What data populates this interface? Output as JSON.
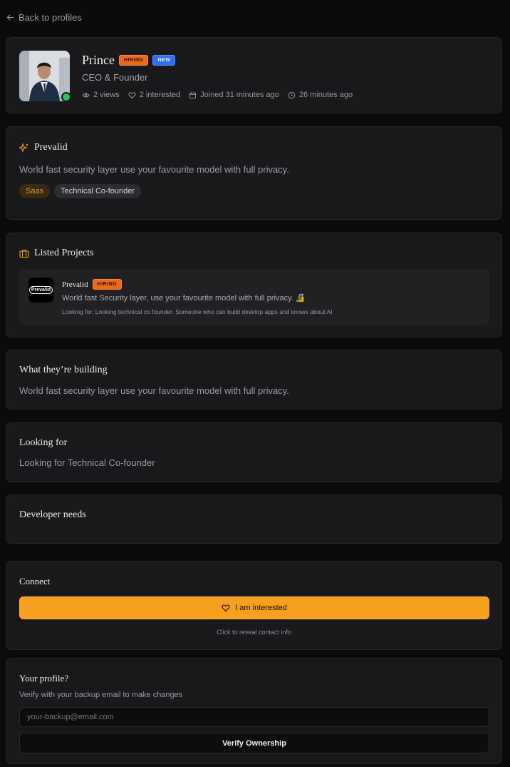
{
  "nav": {
    "back_label": "Back to profiles"
  },
  "profile": {
    "name": "Prince",
    "badges": {
      "hiring": "HIRING",
      "new": "NEW"
    },
    "role": "CEO & Founder",
    "stats": {
      "views": "2 views",
      "interested": "2 interested",
      "joined": "Joined 31 minutes ago",
      "updated": "26 minutes ago"
    },
    "online_color": "#22c55e"
  },
  "company": {
    "name": "Prevalid",
    "description": "World fast security layer use your favourite model with full privacy.",
    "tags": [
      "Saas",
      "Technical Co-founder"
    ]
  },
  "listed_projects": {
    "title": "Listed Projects",
    "project": {
      "logo_text": "Prevalid",
      "name": "Prevalid",
      "badge": "HIRING",
      "description": "World fast Security layer, use your favourite model with full privacy. 🔏",
      "looking_for": "Looking for: Looking technical co founder. Someone who can build desktop apps and knows about AI"
    }
  },
  "building": {
    "title": "What they’re building",
    "text": "World fast security layer use your favourite model with full privacy."
  },
  "looking_for": {
    "title": "Looking for",
    "text": "Looking for Technical Co-founder"
  },
  "developer_needs": {
    "title": "Developer needs"
  },
  "connect": {
    "title": "Connect",
    "button_label": "I am interested",
    "hint": "Click to reveal contact info",
    "accent": "#f7a020"
  },
  "ownership": {
    "title": "Your profile?",
    "subtitle": "Verify with your backup email to make changes",
    "email_placeholder": "your-backup@email.com",
    "button_label": "Verify Ownership"
  }
}
